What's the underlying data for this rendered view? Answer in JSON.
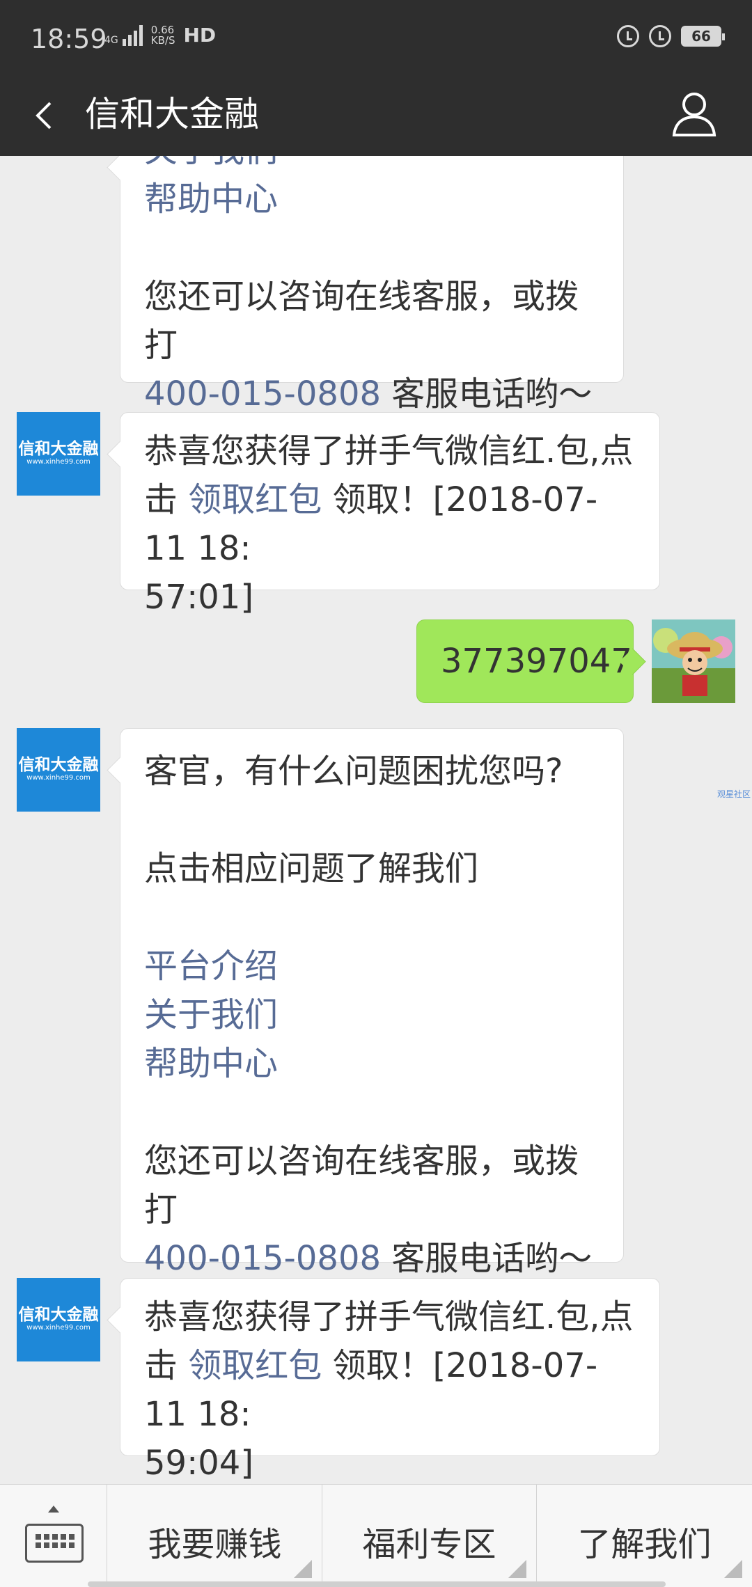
{
  "status_bar": {
    "time": "18:59",
    "network": "4G",
    "speed_value": "0.66",
    "speed_unit": "KB/S",
    "hd": "HD",
    "battery": "66"
  },
  "header": {
    "title": "信和大金融"
  },
  "logo_avatar": {
    "line1": "信和大金融",
    "line2": "www.xinhe99.com"
  },
  "messages": {
    "m1": {
      "cut_top": "关于我们",
      "help": "帮助中心",
      "contact_text": "您还可以咨询在线客服，或拨打",
      "phone": "400-015-0808",
      "phone_suffix": " 客服电话哟～"
    },
    "m2": {
      "line1": "恭喜您获得了拼手气微信红.包,点",
      "line2_prefix": "击 ",
      "link": "领取红包",
      "line2_suffix": " 领取！[2018-07-11 18:",
      "line3": "57:01]"
    },
    "m3": {
      "text": "377397047"
    },
    "m4": {
      "question": "客官，有什么问题困扰您吗?",
      "hint": "点击相应问题了解我们",
      "link1": "平台介绍",
      "link2": "关于我们",
      "link3": "帮助中心",
      "contact_text": "您还可以咨询在线客服，或拨打",
      "phone": "400-015-0808",
      "phone_suffix": " 客服电话哟～"
    },
    "m5": {
      "line1": "恭喜您获得了拼手气微信红.包,点",
      "line2_prefix": "击 ",
      "link": "领取红包",
      "line2_suffix": " 领取！[2018-07-11 18:",
      "line3": "59:04]"
    }
  },
  "watermark": "观星社区",
  "menu": {
    "item1": "我要赚钱",
    "item2": "福利专区",
    "item3": "了解我们"
  }
}
